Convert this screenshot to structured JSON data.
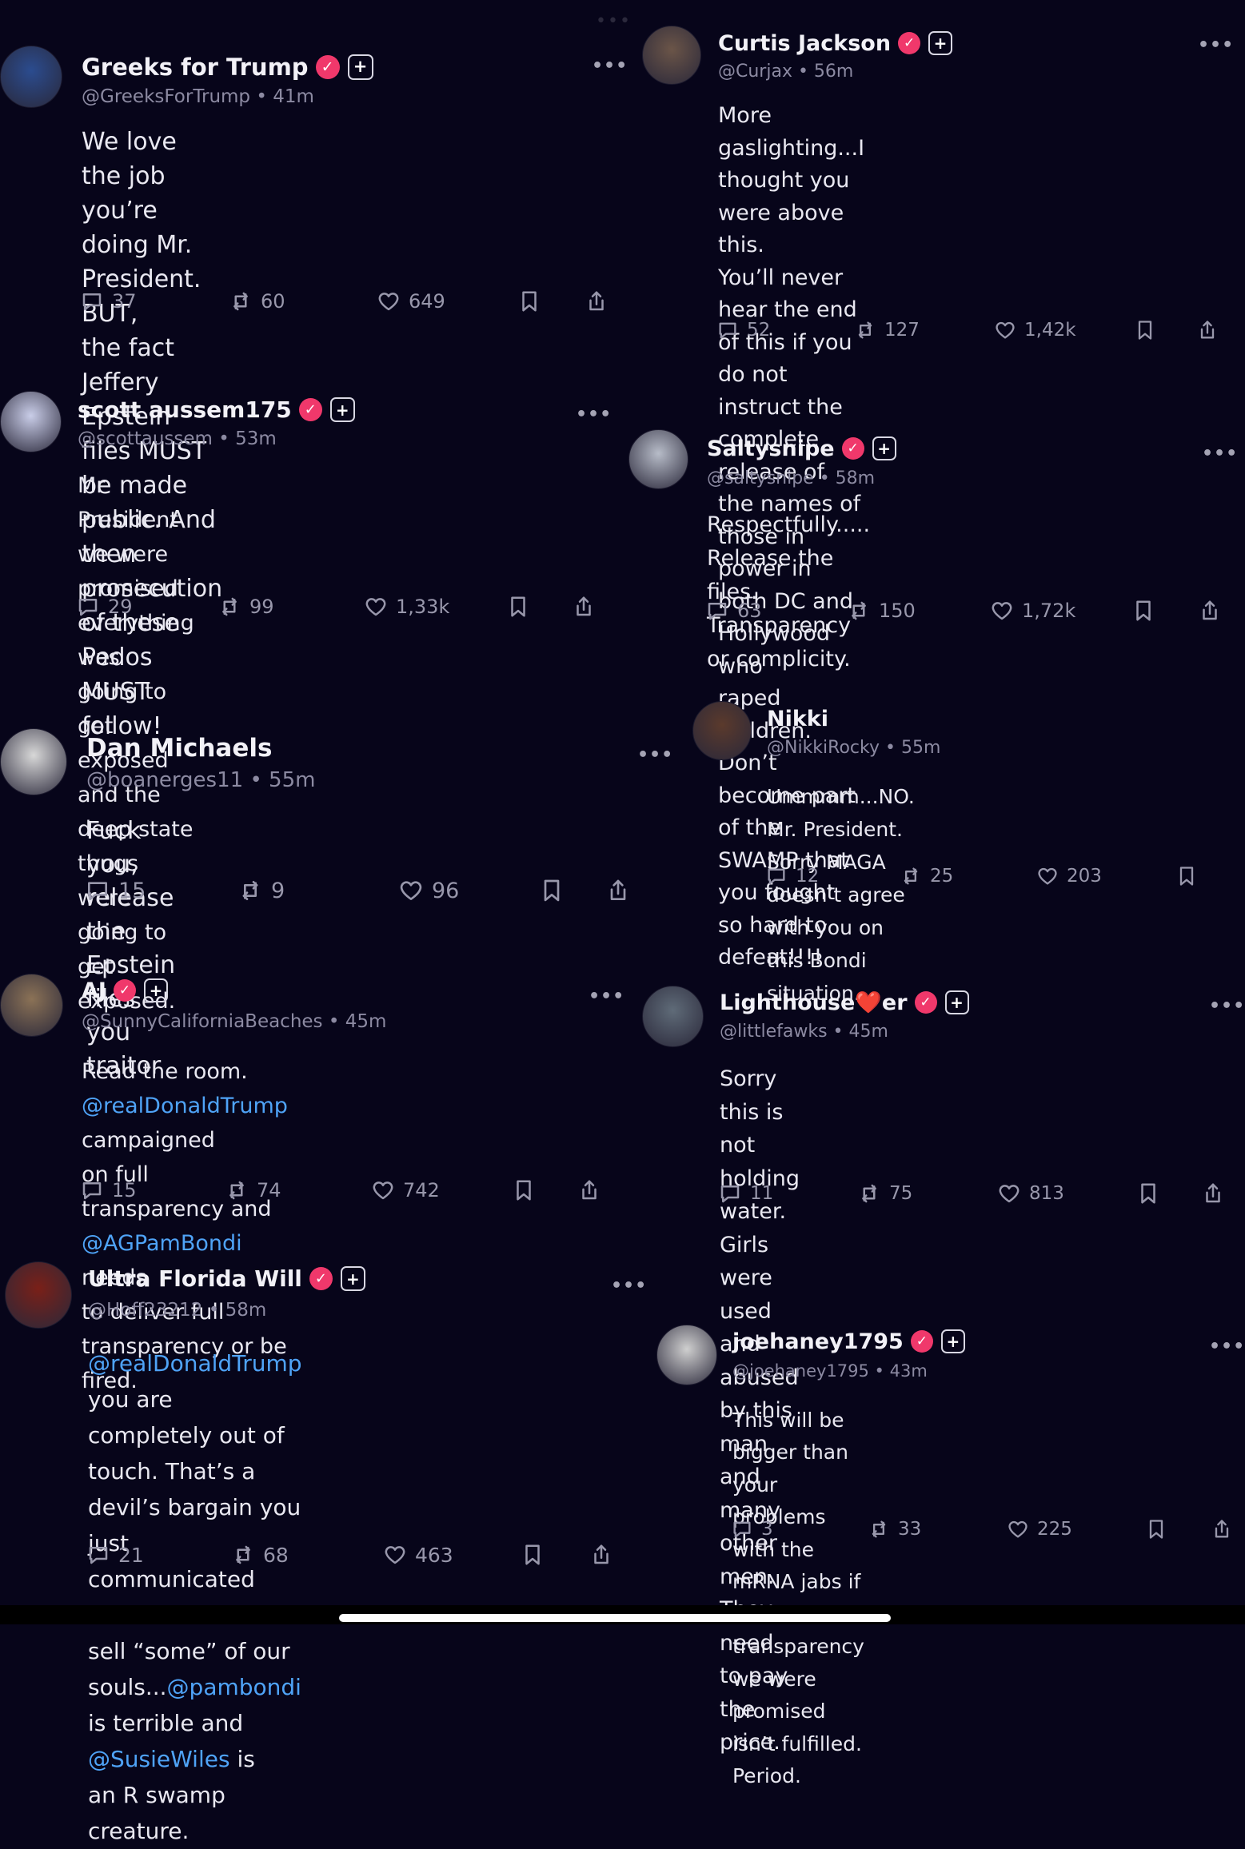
{
  "accent_color": "#f0386b",
  "mention_color": "#4fa3f7",
  "verified_icon": "verified-badge-icon",
  "follow_icon": "plus-icon",
  "posts": [
    {
      "name": "Greeks for Trump",
      "handle": "@GreeksForTrump",
      "time": "41m",
      "meta": "@GreeksForTrump • 41m",
      "lines": [
        [
          "We love the job you’re doing Mr. President. BUT,"
        ],
        [
          "the fact Jeffery Epstein files MUST be made"
        ],
        [
          "public. And then prosecution of these Pedos"
        ],
        [
          "MUST follow!"
        ]
      ],
      "replies": "37",
      "reposts": "60",
      "likes": "649"
    },
    {
      "name": "Curtis Jackson",
      "handle": "@Curjax",
      "time": "56m",
      "meta": "@Curjax • 56m",
      "lines": [
        [
          "More gaslighting...I thought you were above this."
        ],
        [
          "You’ll never hear the end of this if you do not"
        ],
        [
          "instruct the complete release of the names of"
        ],
        [
          "those in power in both DC and Hollywood who"
        ],
        [
          "raped children. Don’t become part of the"
        ],
        [
          "SWAMP that you fought so hard to defeat!!!!"
        ]
      ],
      "replies": "52",
      "reposts": "127",
      "likes": "1,42k"
    },
    {
      "name": "scott aussem175",
      "handle": "@scottaussem",
      "time": "53m",
      "meta": "@scottaussem • 53m",
      "lines": [
        [
          "Mr President we were promised everything was"
        ],
        [
          "going to get exposed and the deep state thugs"
        ],
        [
          "were going to get exposed."
        ]
      ],
      "replies": "29",
      "reposts": "99",
      "likes": "1,33k"
    },
    {
      "name": "Saltysnipe",
      "handle": "@saltysnipe",
      "time": "58m",
      "meta": "@saltysnipe • 58m",
      "lines": [
        [
          "Respectfully..... Release the files. Transparency"
        ],
        [
          "or complicity."
        ]
      ],
      "replies": "63",
      "reposts": "150",
      "likes": "1,72k"
    },
    {
      "name": "Dan Michaels",
      "handle": "@boanerges11",
      "time": "55m",
      "meta": "@boanerges11 • 55m",
      "lines": [
        [
          "Fuck you, release the Epstein files you traitor"
        ]
      ],
      "replies": "15",
      "reposts": "9",
      "likes": "96"
    },
    {
      "name": "Nikki",
      "handle": "@NikkiRocky",
      "time": "55m",
      "meta": "@NikkiRocky • 55m",
      "lines": [
        [
          "Ummmm...NO. Mr. President. Sorry MAGA"
        ],
        [
          "doesn’t agree with you on this Bondi situation."
        ]
      ],
      "replies": "12",
      "reposts": "25",
      "likes": "203"
    },
    {
      "name": "AJ",
      "handle": "@SunnyCaliforniaBeaches",
      "time": "45m",
      "meta": "@SunnyCaliforniaBeaches • 45m",
      "lines": [
        [
          "Read the room. ",
          "@realDonaldTrump",
          " campaigned"
        ],
        [
          "on full transparency and ",
          "@AGPamBondi",
          " needs"
        ],
        [
          "to deliver full transparency or be fired."
        ]
      ],
      "replies": "15",
      "reposts": "74",
      "likes": "742"
    },
    {
      "name": "Lighthouse❤️er",
      "handle": "@littlefawks",
      "time": "45m",
      "meta": "@littlefawks • 45m",
      "lines": [
        [
          "Sorry this is not holding water. Girls were used"
        ],
        [
          "and abused by this man and many other men."
        ],
        [
          "They need to pay the price."
        ]
      ],
      "replies": "11",
      "reposts": "75",
      "likes": "813"
    },
    {
      "name": "Ultra Florida Will",
      "handle": "@Hoff23212",
      "time": "58m",
      "meta": "@Hoff23212 • 58m",
      "lines": [
        [
          "",
          "@realDonaldTrump",
          " you are completely out of"
        ],
        [
          "touch. That’s a devil’s bargain you just"
        ],
        [
          "communicated there. We can’t sell “some” of our"
        ],
        [
          "souls...",
          "@pambondi",
          " is terrible and ",
          "@SusieWiles",
          " is"
        ],
        [
          "an R swamp creature."
        ]
      ],
      "replies": "21",
      "reposts": "68",
      "likes": "463"
    },
    {
      "name": "joehaney1795",
      "handle": "@joehaney1795",
      "time": "43m",
      "meta": "@joehaney1795 • 43m",
      "lines": [
        [
          "This will be bigger than your problems with the"
        ],
        [
          "mRNA jabs if the transparency we were"
        ],
        [
          "promised isn’t fulfilled. Period."
        ]
      ],
      "replies": "3",
      "reposts": "33",
      "likes": "225"
    }
  ]
}
